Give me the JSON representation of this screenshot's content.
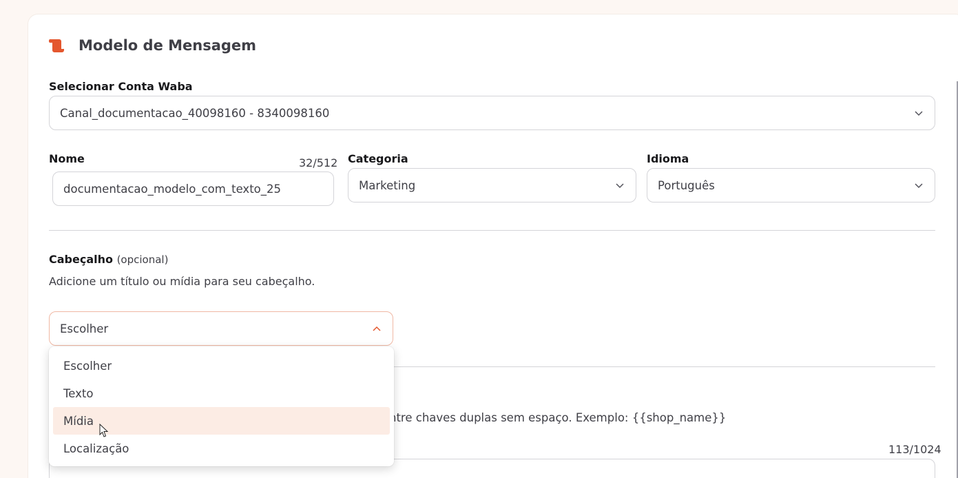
{
  "header": {
    "title": "Modelo de Mensagem",
    "icon": "scroll-icon"
  },
  "waba": {
    "label": "Selecionar Conta Waba",
    "value": "Canal_documentacao_40098160 - 8340098160"
  },
  "nome": {
    "label": "Nome",
    "counter": "32/512",
    "value": "documentacao_modelo_com_texto_25"
  },
  "categoria": {
    "label": "Categoria",
    "value": "Marketing"
  },
  "idioma": {
    "label": "Idioma",
    "value": "Português"
  },
  "cabecalho": {
    "label": "Cabeçalho",
    "optional": "(opcional)",
    "description": "Adicione um título ou mídia para seu cabeçalho.",
    "select_value": "Escolher",
    "options": [
      "Escolher",
      "Texto",
      "Mídia",
      "Localização"
    ],
    "hovered_option": "Mídia"
  },
  "corpo": {
    "partial_description": "ntre chaves duplas sem espaço. Exemplo: {{shop_name}}",
    "counter": "113/1024"
  },
  "colors": {
    "accent": "#e4572e",
    "hover_bg": "#fcece4",
    "border": "#d4d4d8",
    "page_bg": "#fdf7f3"
  }
}
